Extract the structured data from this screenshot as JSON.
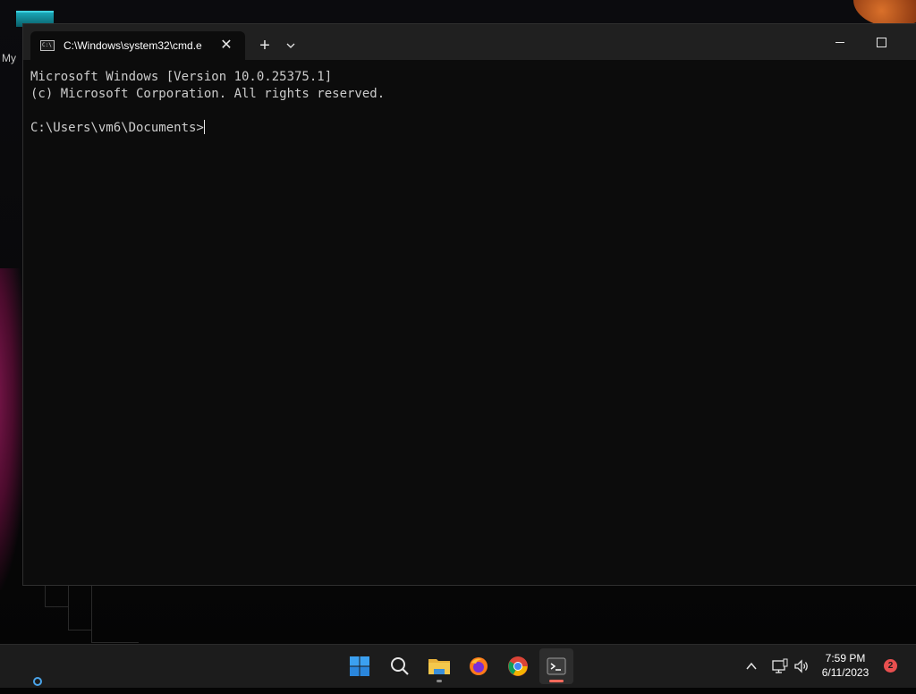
{
  "desktop": {
    "partial_icon_label": "My"
  },
  "window": {
    "tab_title": "C:\\Windows\\system32\\cmd.e",
    "tab_close_icon": "close-icon",
    "new_tab_label": "+",
    "dropdown_icon": "chevron-down-icon",
    "minimize_icon": "minimize-icon",
    "maximize_icon": "maximize-icon"
  },
  "console": {
    "lines": [
      "Microsoft Windows [Version 10.0.25375.1]",
      "(c) Microsoft Corporation. All rights reserved.",
      "",
      "C:\\Users\\vm6\\Documents>"
    ]
  },
  "taskbar": {
    "apps": [
      {
        "name": "Start",
        "icon": "windows-start-icon"
      },
      {
        "name": "Search",
        "icon": "search-icon"
      },
      {
        "name": "File Explorer",
        "icon": "folder-icon"
      },
      {
        "name": "Firefox",
        "icon": "firefox-icon"
      },
      {
        "name": "Chrome",
        "icon": "chrome-icon"
      },
      {
        "name": "Terminal",
        "icon": "terminal-icon"
      }
    ],
    "clock_time": "7:59 PM",
    "clock_date": "6/11/2023",
    "notification_count": "2",
    "colors": {
      "accent": "#0078d4",
      "terminal_indicator": "#ff6a5c",
      "notification": "#e84f4f"
    }
  }
}
